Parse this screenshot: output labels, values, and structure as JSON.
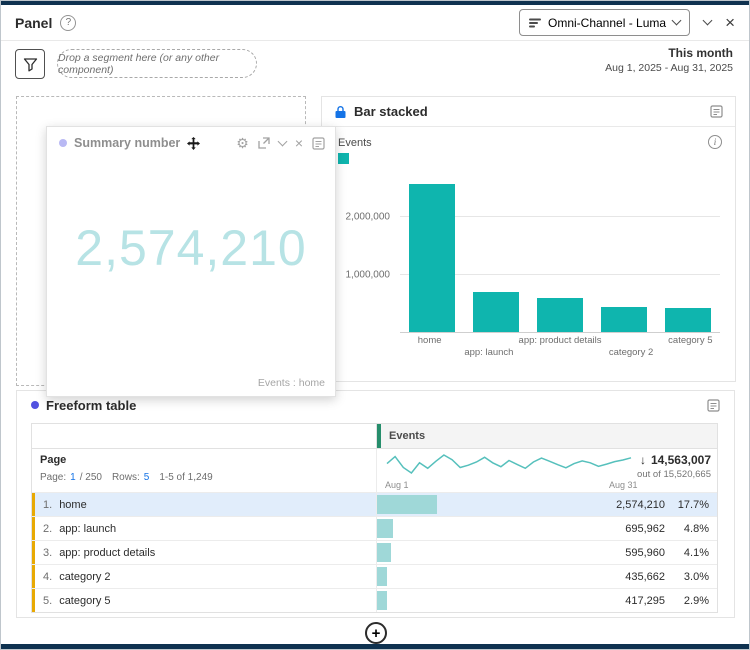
{
  "colors": {
    "navy": "#0f3250",
    "teal": "#0fb5ae",
    "teal_light": "#b7e3e5",
    "table_bar": "#9fd8d8",
    "spark": "#56c0bc",
    "link_blue": "#1473e6",
    "lock_blue": "#1473e6",
    "green": "#268e6c",
    "yellow": "#e8a903",
    "purple": "#5252e0",
    "purple_light": "#b9b9f4",
    "row_highlight": "#e1edfb"
  },
  "panel": {
    "title": "Panel",
    "help_icon": "?",
    "segment_dropdown": "Omni-Channel - Luma",
    "drop_zone": "Drop a segment here (or any other component)",
    "date_range_label": "This month",
    "date_range": "Aug 1, 2025 - Aug 31, 2025"
  },
  "summary_number": {
    "title": "Summary number",
    "value": "2,574,210",
    "caption": "Events : home"
  },
  "bar_chart": {
    "title": "Bar stacked",
    "legend_label": "Events"
  },
  "freeform_table": {
    "title": "Freeform table",
    "column_header": "Events",
    "dimension_header": "Page",
    "pagination": {
      "page_label": "Page:",
      "page_current": "1",
      "page_total": "/ 250",
      "rows_label": "Rows:",
      "rows_value": "5",
      "range": "1-5 of 1,249"
    },
    "spark_start": "Aug 1",
    "spark_end": "Aug 31",
    "sort_icon": "↓",
    "total": "14,563,007",
    "total_sub": "out of 15,520,665",
    "rows": [
      {
        "index": "1.",
        "name": "home",
        "value": "2,574,210",
        "pct": "17.7%",
        "bar_pct": 17.7,
        "selected": true
      },
      {
        "index": "2.",
        "name": "app: launch",
        "value": "695,962",
        "pct": "4.8%",
        "bar_pct": 4.8,
        "selected": false
      },
      {
        "index": "3.",
        "name": "app: product details",
        "value": "595,960",
        "pct": "4.1%",
        "bar_pct": 4.1,
        "selected": false
      },
      {
        "index": "4.",
        "name": "category 2",
        "value": "435,662",
        "pct": "3.0%",
        "bar_pct": 3.0,
        "selected": false
      },
      {
        "index": "5.",
        "name": "category 5",
        "value": "417,295",
        "pct": "2.9%",
        "bar_pct": 2.9,
        "selected": false
      }
    ],
    "add_button": "+"
  },
  "chart_data": [
    {
      "type": "bar",
      "title": "Bar stacked",
      "categories": [
        "home",
        "app: launch",
        "app: product details",
        "category 2",
        "category 5"
      ],
      "series": [
        {
          "name": "Events",
          "values": [
            2574210,
            695962,
            595960,
            435662,
            417295
          ]
        }
      ],
      "yticks": [
        1000000,
        2000000
      ],
      "ytick_labels": [
        "1,000,000",
        "2,000,000"
      ],
      "ylim": [
        0,
        3000000
      ],
      "legend": [
        "Events"
      ],
      "legend_position": "top-left",
      "grid": true
    },
    {
      "type": "line",
      "title": "Events daily trend (sparkline)",
      "x_start_label": "Aug 1",
      "x_end_label": "Aug 31",
      "values": [
        455000,
        500000,
        430000,
        395000,
        460000,
        425000,
        470000,
        510000,
        480000,
        430000,
        445000,
        465000,
        495000,
        460000,
        435000,
        475000,
        450000,
        425000,
        465000,
        490000,
        470000,
        448000,
        428000,
        455000,
        472000,
        460000,
        438000,
        452000,
        468000,
        478000,
        492000
      ]
    }
  ]
}
